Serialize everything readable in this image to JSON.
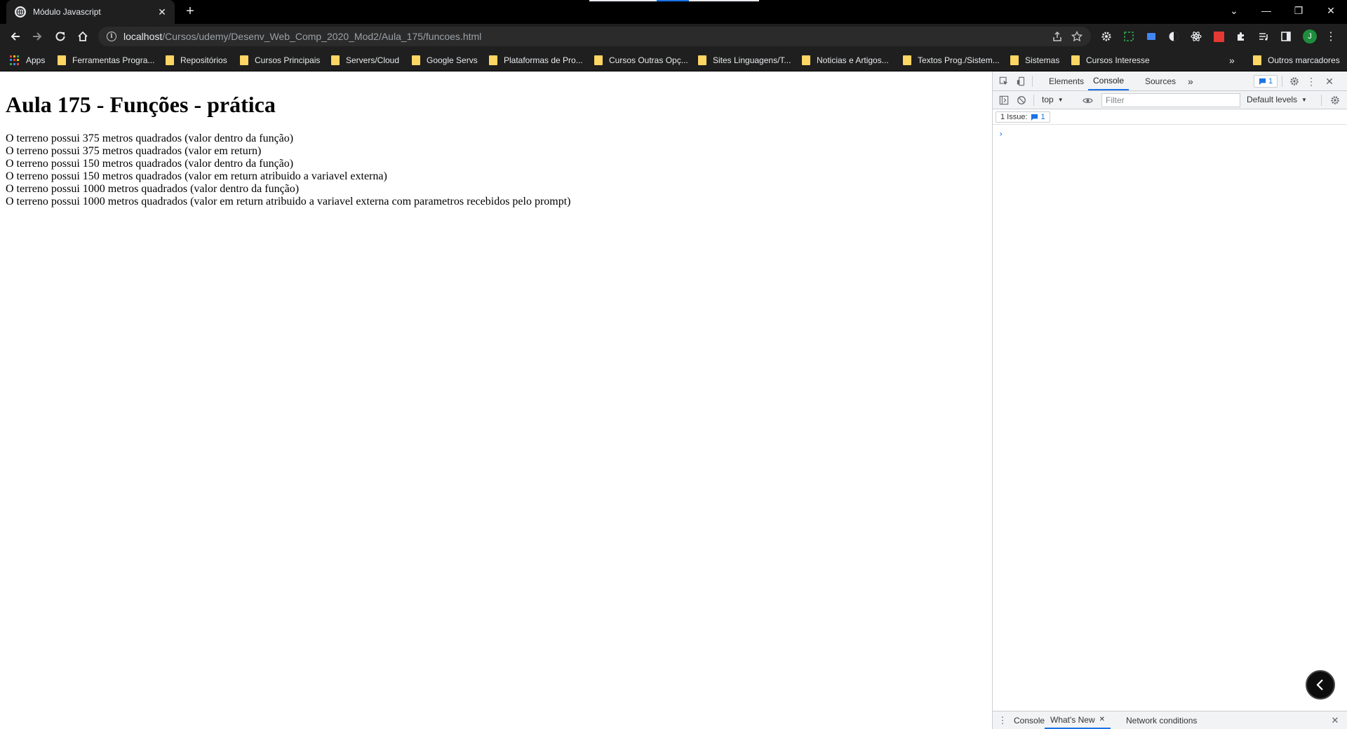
{
  "browser": {
    "tab": {
      "title": "Módulo Javascript",
      "close_glyph": "✕"
    },
    "new_tab_glyph": "+",
    "window_controls": {
      "dropdown": "⌄",
      "minimize": "—",
      "restore": "❐",
      "close": "✕"
    },
    "address": {
      "host": "localhost",
      "path": "/Cursos/udemy/Desenv_Web_Comp_2020_Mod2/Aula_175/funcoes.html"
    },
    "profile_initial": "J",
    "bookmarks": [
      "Apps",
      "Ferramentas Progra...",
      "Repositórios",
      "Cursos Principais",
      "Servers/Cloud",
      "Google Servs",
      "Plataformas de Pro...",
      "Cursos Outras Opç...",
      "Sites Linguagens/T...",
      "Noticias e Artigos...",
      "Textos Prog./Sistem...",
      "Sistemas",
      "Cursos Interesse"
    ],
    "bookmarks_overflow": "»",
    "other_bookmarks": "Outros marcadores"
  },
  "page": {
    "heading": "Aula 175 - Funções - prática",
    "lines": [
      "O terreno possui 375 metros quadrados (valor dentro da função)",
      "O terreno possui 375 metros quadrados (valor em return)",
      "O terreno possui 150 metros quadrados (valor dentro da função)",
      "O terreno possui 150 metros quadrados (valor em return atribuido a variavel externa)",
      "O terreno possui 1000 metros quadrados (valor dentro da função)",
      "O terreno possui 1000 metros quadrados (valor em return atribuido a variavel externa com parametros recebidos pelo prompt)"
    ]
  },
  "devtools": {
    "tabs": [
      "Elements",
      "Console",
      "Sources"
    ],
    "active_tab": "Console",
    "more_tabs": "»",
    "issues_badge_count": "1",
    "context": "top",
    "filter_placeholder": "Filter",
    "levels": "Default levels",
    "issues_label": "1 Issue:",
    "issues_count": "1",
    "prompt_glyph": "›",
    "drawer": {
      "tabs": [
        "Console",
        "What's New",
        "Network conditions"
      ],
      "active": "What's New",
      "close_glyph": "✕"
    }
  },
  "colors": {
    "chrome_bg": "#1f1f1f",
    "folder": "#fdd663",
    "accent": "#1a73e8",
    "profile": "#1e8e3e",
    "ext_red": "#e53935",
    "apps_grid": [
      "#ea4335",
      "#fbbc04",
      "#34a853",
      "#4285f4"
    ]
  }
}
